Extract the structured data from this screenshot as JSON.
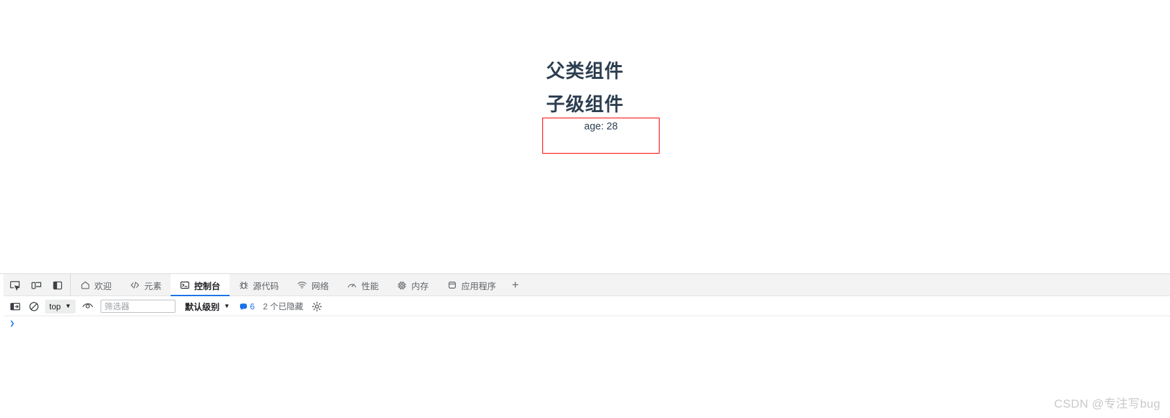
{
  "page": {
    "parent_heading": "父类组件",
    "child_heading": "子级组件",
    "age_label": "age: 28",
    "highlight_color": "#ff0000",
    "heading_color": "#2c3e50"
  },
  "devtools": {
    "dock_buttons": [
      {
        "name": "inspect-element-icon",
        "title": "检查"
      },
      {
        "name": "device-toolbar-icon",
        "title": "设备工具栏"
      },
      {
        "name": "dock-side-icon",
        "title": "停靠位置"
      }
    ],
    "tabs": [
      {
        "label": "欢迎",
        "icon": "home-icon",
        "active": false
      },
      {
        "label": "元素",
        "icon": "code-brackets-icon",
        "active": false
      },
      {
        "label": "控制台",
        "icon": "console-terminal-icon",
        "active": true
      },
      {
        "label": "源代码",
        "icon": "bug-icon",
        "active": false
      },
      {
        "label": "网络",
        "icon": "wifi-icon",
        "active": false
      },
      {
        "label": "性能",
        "icon": "gauge-icon",
        "active": false
      },
      {
        "label": "内存",
        "icon": "memory-chip-icon",
        "active": false
      },
      {
        "label": "应用程序",
        "icon": "database-icon",
        "active": false
      }
    ],
    "add_tab_label": "+",
    "console_toolbar": {
      "sidebar_toggle_icon": "console-sidebar-icon",
      "clear_console_icon": "no-entry-icon",
      "context": "top",
      "context_caret": "▼",
      "live_expression_icon": "eye-icon",
      "filter_placeholder": "筛选器",
      "filter_value": "",
      "level_label": "默认级别",
      "level_caret": "▼",
      "message_count": "6",
      "hidden_label": "2 个已隐藏",
      "settings_icon": "gear-icon",
      "accent_color": "#1a73e8"
    },
    "prompt": {
      "chevron": "❯",
      "value": ""
    }
  },
  "watermark": {
    "text": "CSDN @专注写bug"
  }
}
